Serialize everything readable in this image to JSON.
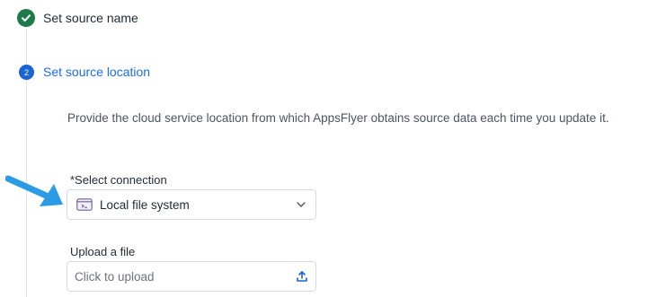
{
  "steps": [
    {
      "title": "Set source name",
      "state": "done",
      "icon": "check-icon"
    },
    {
      "number": "2",
      "title": "Set source location",
      "state": "active"
    }
  ],
  "description": "Provide the cloud service location from which AppsFlyer obtains source data each time you update it.",
  "connection": {
    "label": "*Select connection",
    "value": "Local file system",
    "icon": "local-file-system-icon"
  },
  "upload": {
    "label": "Upload a file",
    "placeholder": "Click to upload",
    "icon": "upload-icon"
  },
  "colors": {
    "done": "#1f7a4a",
    "active": "#1b64d6",
    "active_text": "#1a6ee8",
    "annotation_arrow": "#2b9be6"
  }
}
